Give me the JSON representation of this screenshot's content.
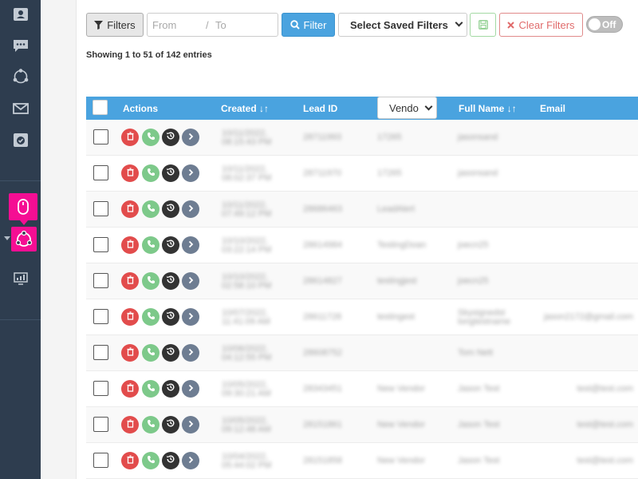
{
  "sidebar": {
    "icons": [
      {
        "name": "contact-card-icon"
      },
      {
        "name": "chat-icon"
      },
      {
        "name": "network-icon"
      },
      {
        "name": "mail-icon"
      },
      {
        "name": "task-check-icon"
      },
      {
        "name": "mouse-icon",
        "highlighted": true
      },
      {
        "name": "hub-icon",
        "highlighted": true
      },
      {
        "name": "monitor-chart-icon"
      }
    ],
    "highlight_color": "#f50e93",
    "bg_color": "#2e3d4f"
  },
  "toolbar": {
    "filters_label": "Filters",
    "from_placeholder": "From",
    "range_sep": "/",
    "to_placeholder": "To",
    "filter_label": "Filter",
    "saved_filters_label": "Select Saved Filters",
    "clear_filters_label": "Clear Filters",
    "toggle_label": "Off"
  },
  "entries_text": "Showing 1 to 51 of 142 entries",
  "table": {
    "header_color": "#4aa3df",
    "columns": {
      "actions": "Actions",
      "created": "Created",
      "lead_id": "Lead ID",
      "vendor": "Vendo",
      "full_name": "Full Name",
      "email": "Email"
    },
    "rows": [
      {
        "created": [
          "10/11/2022,",
          "08:15:43 PM"
        ],
        "lead_id": "28711993",
        "vendor": "17265",
        "full_name": "jasonsand",
        "email": ""
      },
      {
        "created": [
          "10/11/2022,",
          "08:02:37 PM"
        ],
        "lead_id": "28711970",
        "vendor": "17265",
        "full_name": "jasonsand",
        "email": ""
      },
      {
        "created": [
          "10/11/2022,",
          "07:49:12 PM"
        ],
        "lead_id": "28686463",
        "vendor": "LeadAlert",
        "full_name": "",
        "email": ""
      },
      {
        "created": [
          "10/10/2022,",
          "03:22:14 PM"
        ],
        "lead_id": "28614984",
        "vendor": "TestingDoan",
        "full_name": "joecn25",
        "email": ""
      },
      {
        "created": [
          "10/10/2022,",
          "02:58:10 PM"
        ],
        "lead_id": "28614827",
        "vendor": "testingjest",
        "full_name": "joecn25",
        "email": ""
      },
      {
        "created": [
          "10/07/2022,",
          "11:41:09 AM"
        ],
        "lead_id": "28611728",
        "vendor": "testingest",
        "full_name": [
          "Skysignedst",
          "longtestname"
        ],
        "email": "jason2172@gmail.com"
      },
      {
        "created": [
          "10/06/2022,",
          "04:12:55 PM"
        ],
        "lead_id": "28608752",
        "vendor": "",
        "full_name": "Tom Nett",
        "email": ""
      },
      {
        "created": [
          "10/05/2022,",
          "09:30:21 AM"
        ],
        "lead_id": "28343451",
        "vendor": "New Vendor",
        "full_name": "Jason Test",
        "email": "test@test.com"
      },
      {
        "created": [
          "10/05/2022,",
          "09:12:48 AM"
        ],
        "lead_id": "28151861",
        "vendor": "New Vendor",
        "full_name": "Jason Test",
        "email": "test@test.com"
      },
      {
        "created": [
          "10/04/2022,",
          "05:44:02 PM"
        ],
        "lead_id": "28151858",
        "vendor": "New Vendor",
        "full_name": "Jason Test",
        "email": "test@test.com"
      }
    ]
  }
}
